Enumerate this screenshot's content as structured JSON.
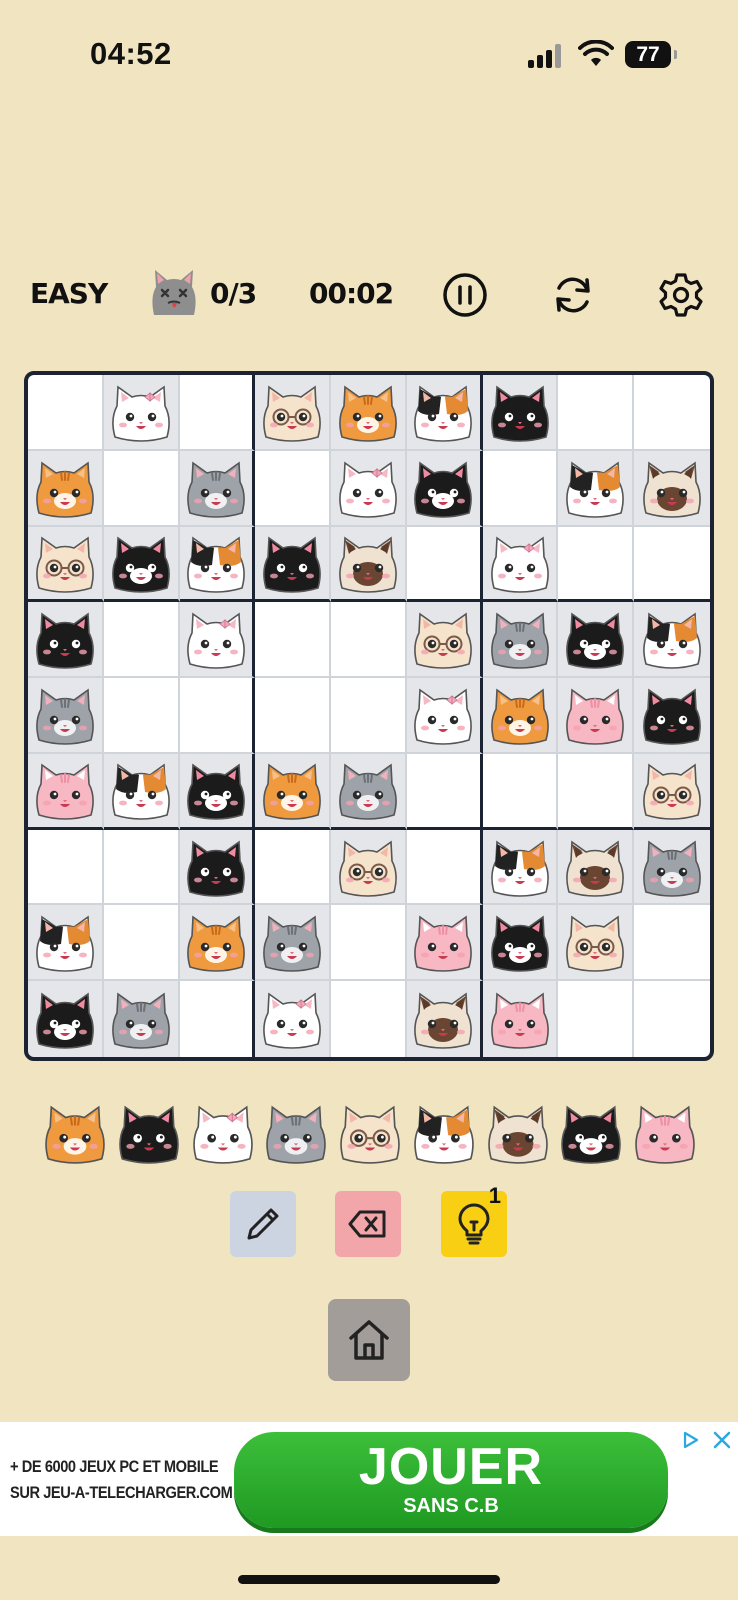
{
  "status_bar": {
    "time": "04:52",
    "battery": "77"
  },
  "header": {
    "difficulty": "EASY",
    "mistakes": "0/3",
    "timer": "00:02"
  },
  "board": {
    "cells": [
      [
        "",
        "white",
        "",
        "glasses",
        "orange",
        "calico",
        "black",
        "",
        ""
      ],
      [
        "orange",
        "",
        "gray",
        "",
        "white",
        "tuxedo",
        "",
        "calico",
        "siamese"
      ],
      [
        "glasses",
        "tuxedo",
        "calico",
        "black",
        "siamese",
        "",
        "white",
        "",
        ""
      ],
      [
        "black",
        "",
        "white",
        "",
        "",
        "glasses",
        "gray",
        "tuxedo",
        "calico"
      ],
      [
        "gray",
        "",
        "",
        "",
        "",
        "white",
        "orange",
        "pink",
        "black"
      ],
      [
        "pink",
        "calico",
        "tuxedo",
        "orange",
        "gray",
        "",
        "",
        "",
        "glasses"
      ],
      [
        "",
        "",
        "black",
        "",
        "glasses",
        "",
        "calico",
        "siamese",
        "gray"
      ],
      [
        "calico",
        "",
        "orange",
        "gray",
        "",
        "pink",
        "tuxedo",
        "glasses",
        ""
      ],
      [
        "tuxedo",
        "gray",
        "",
        "white",
        "",
        "siamese",
        "pink",
        "",
        ""
      ]
    ]
  },
  "palette": [
    "orange",
    "black",
    "white",
    "gray",
    "glasses",
    "calico",
    "siamese",
    "tuxedo",
    "pink"
  ],
  "tools": {
    "hint_count": "1"
  },
  "ad": {
    "line1": "+ DE 6000 JEUX PC ET MOBILE",
    "line2": "SUR JEU-A-TELECHARGER.COM",
    "button_big": "JOUER",
    "button_small": "SANS C.B"
  },
  "colors": {
    "background": "#f1e4c0",
    "board_border": "#1c2333",
    "hint": "#f8cf13",
    "erase": "#f3a6a9",
    "pencil": "#cbd4e0",
    "ad_button": "#2aae2c"
  }
}
